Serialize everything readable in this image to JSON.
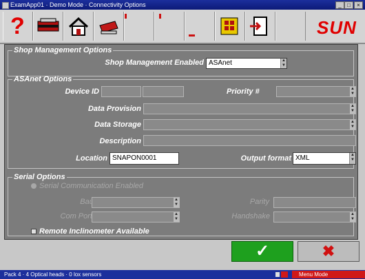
{
  "window": {
    "title": "ExamApp01 · Demo Mode · Connectivity Options",
    "buttons": [
      "_",
      "□",
      "×"
    ]
  },
  "toolbar": {
    "icons": [
      "help-icon",
      "vehicle-icon",
      "home-icon",
      "print-icon",
      "module-icon",
      "exit-icon",
      "sun-logo"
    ],
    "logo_text": "SUN"
  },
  "shop": {
    "legend": "Shop Management Options",
    "enabled_label": "Shop Management Enabled",
    "enabled_value": "ASAnet"
  },
  "asanet": {
    "legend": "ASAnet Options",
    "device_id_label": "Device ID",
    "priority_label": "Priority #",
    "data_provision_label": "Data Provision",
    "data_storage_label": "Data Storage",
    "description_label": "Description",
    "location_label": "Location",
    "location_value": "SNAPON0001",
    "output_format_label": "Output format",
    "output_format_value": "XML"
  },
  "serial": {
    "legend": "Serial Options",
    "comm_enabled_label": "Serial Communication Enabled",
    "baud_label": "Baud",
    "parity_label": "Parity",
    "com_port_label": "Com Port",
    "handshake_label": "Handshake",
    "inclinometer_label": "Remote Inclinometer Available"
  },
  "actions": {
    "ok_icon": "✓",
    "cancel_icon": "✖"
  },
  "status": {
    "text": "Pack 4 · 4 Optical heads · 0 lox sensors",
    "mode": "Menu Mode"
  }
}
